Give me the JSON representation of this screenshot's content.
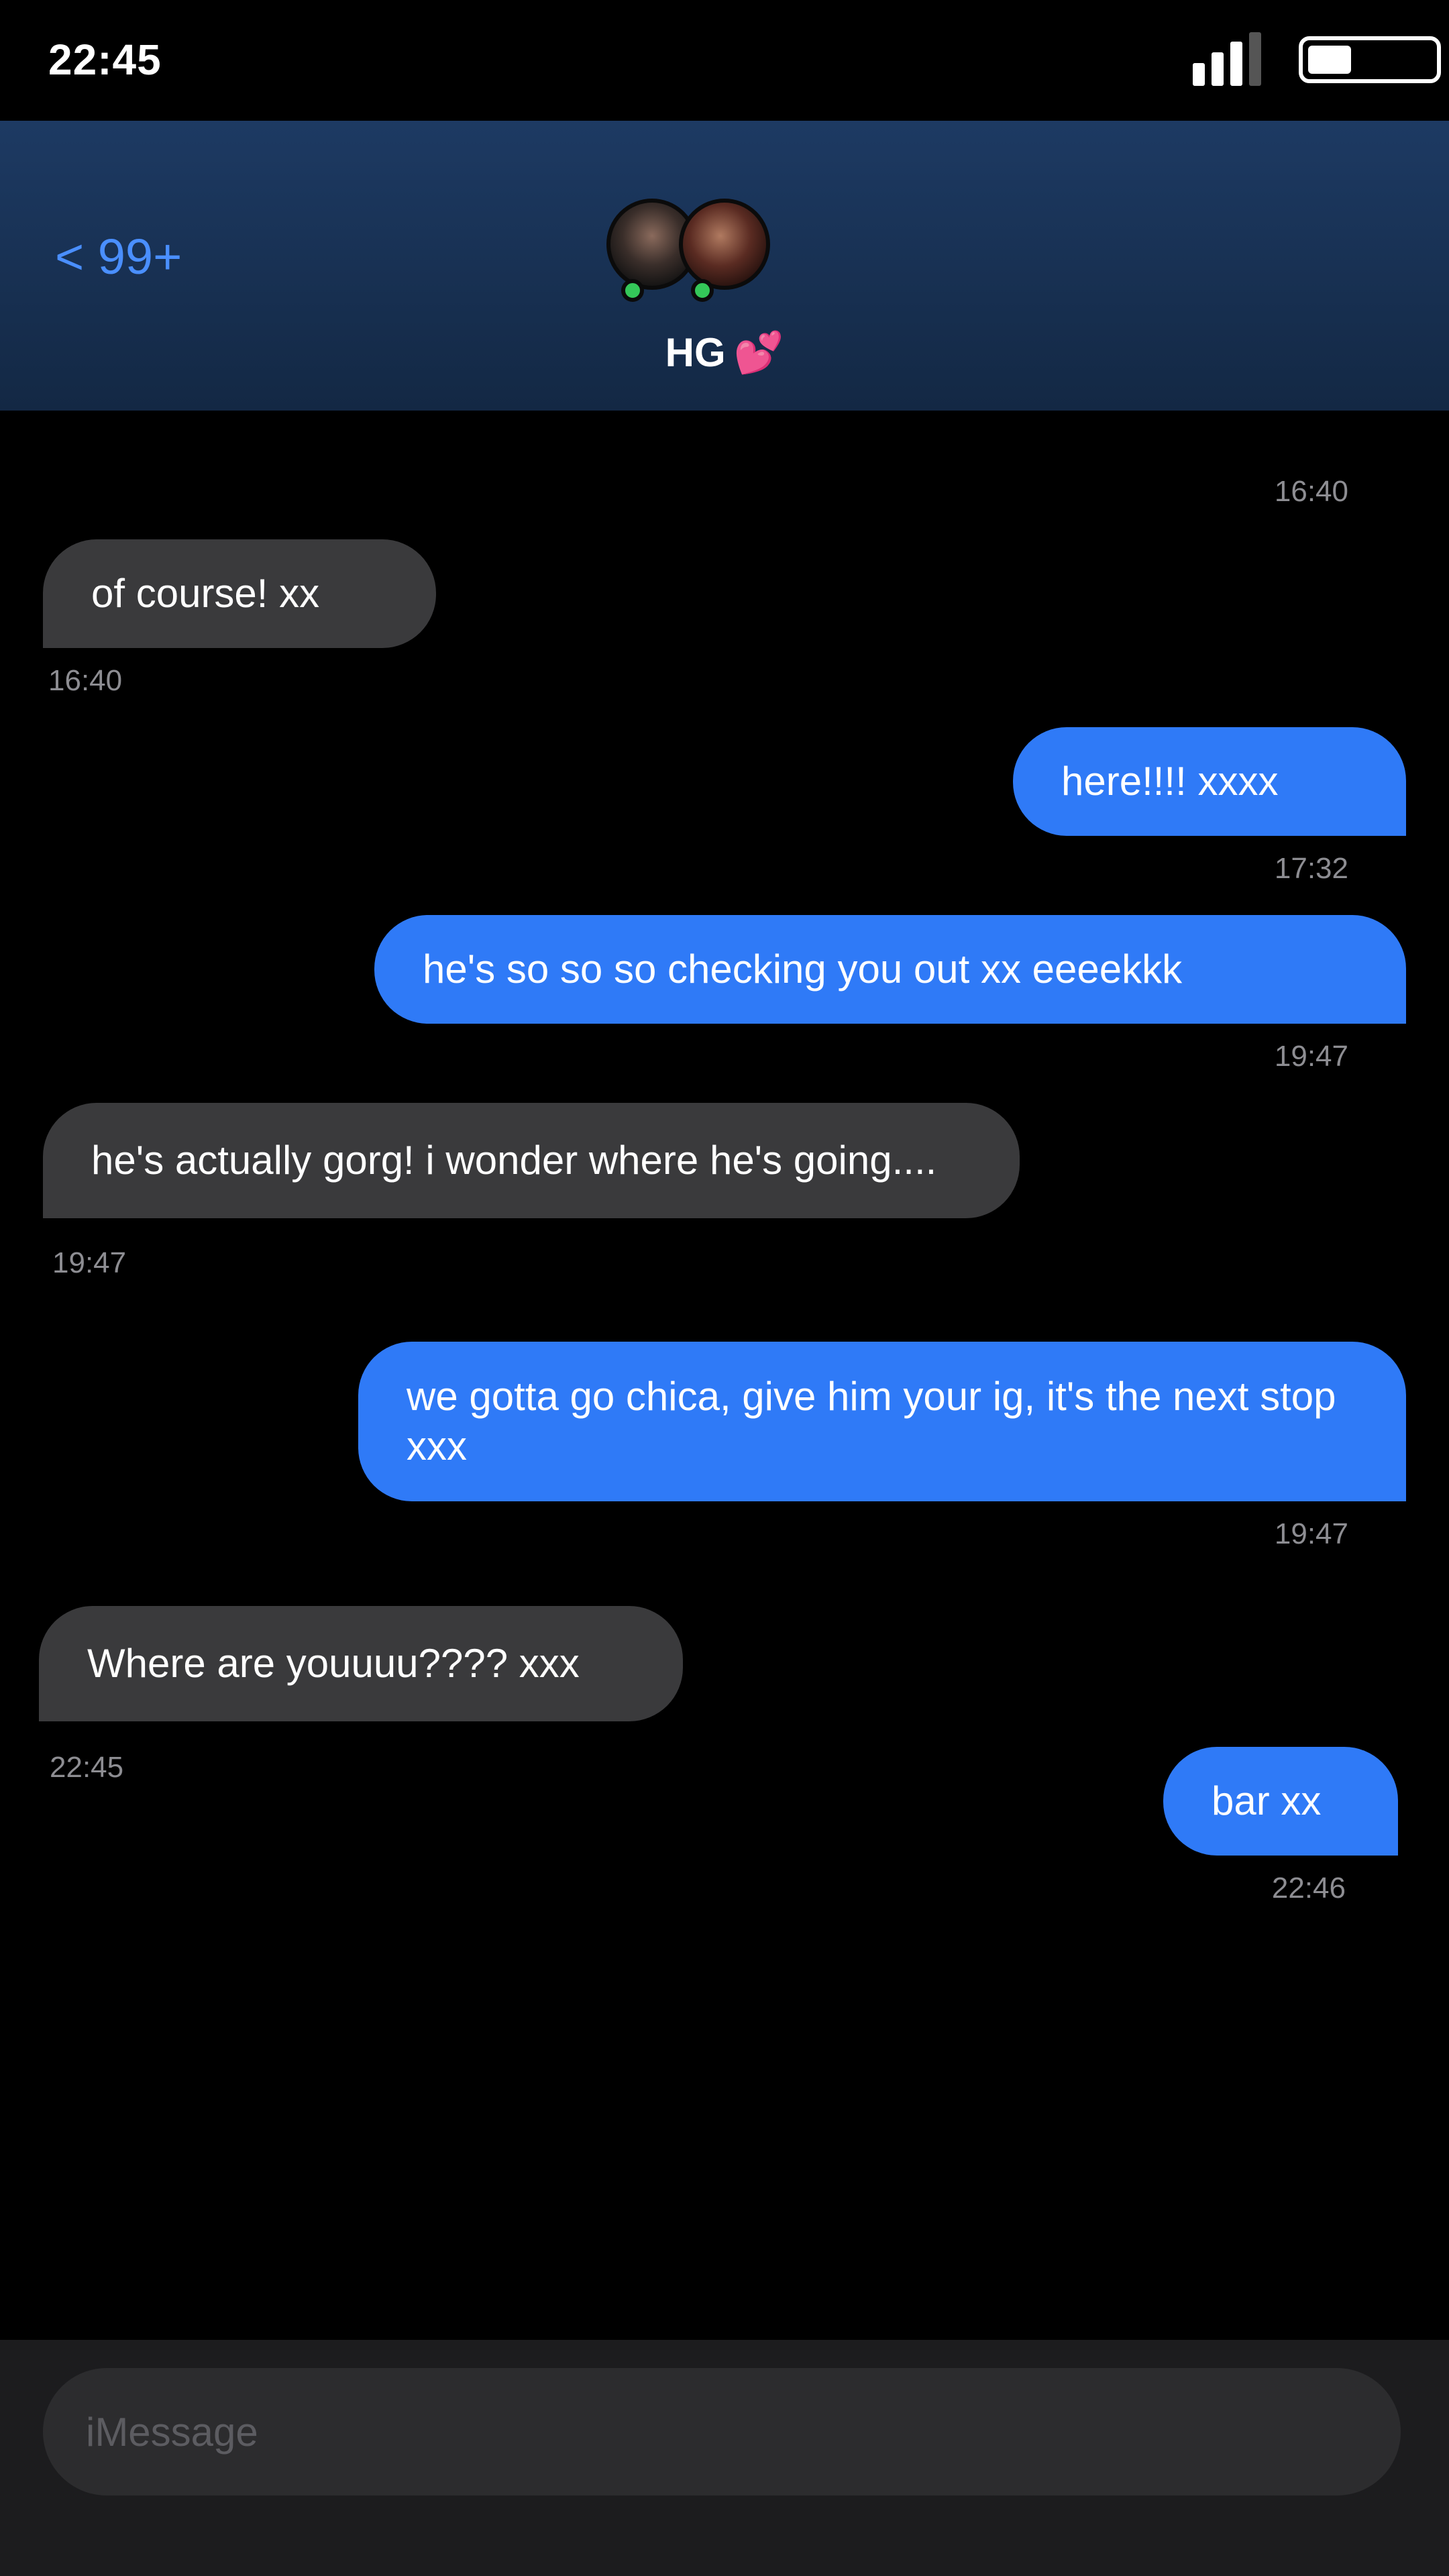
{
  "status_bar": {
    "time": "22:45",
    "signal_bars": 3,
    "battery_level": 0.35
  },
  "header": {
    "back_label": "< 99+",
    "title": "HG",
    "title_emoji": "💕"
  },
  "messages": [
    {
      "top_timestamp": "16:40"
    },
    {
      "direction": "incoming",
      "text": "of course! xx",
      "time": "16:40"
    },
    {
      "direction": "outgoing",
      "text": "here!!!! xxxx",
      "time": "17:32"
    },
    {
      "direction": "outgoing",
      "text": "he's so so so checking you out xx eeeekkk",
      "time": "19:47"
    },
    {
      "direction": "incoming",
      "text": "he's actually gorg! i wonder where he's going....",
      "time": "19:47"
    },
    {
      "direction": "outgoing",
      "text": "we gotta go chica, give him your ig, it's the next stop xxx",
      "time": "19:47"
    },
    {
      "direction": "incoming",
      "text": "Where are youuuu???? xxx",
      "time": "22:45"
    },
    {
      "direction": "outgoing",
      "text": "bar xx",
      "time": "22:46"
    }
  ],
  "composer": {
    "placeholder": "iMessage"
  },
  "colors": {
    "outgoing_bubble": "#2f7af7",
    "incoming_bubble": "#3a3a3c",
    "header_bg": "#1d3a63",
    "accent": "#4a8fff",
    "online": "#34c759"
  }
}
